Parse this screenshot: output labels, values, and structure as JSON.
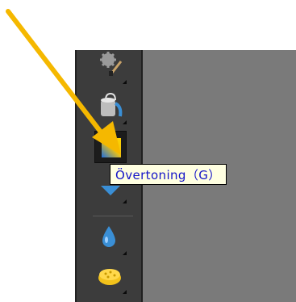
{
  "tooltip": {
    "text": "Övertoning（G）"
  },
  "tools": [
    {
      "name": "gear-brush-tool"
    },
    {
      "name": "paint-bucket-tool"
    },
    {
      "name": "gradient-tool",
      "selected": true
    },
    {
      "name": "shape-tool"
    },
    {
      "name": "blur-drop-tool"
    },
    {
      "name": "sponge-tool"
    }
  ],
  "colors": {
    "toolbar": "#3c3c3c",
    "canvas": "#7a7a7a",
    "annotation_arrow": "#f5b800",
    "tooltip_bg": "#ffffe1",
    "tooltip_text": "#1414c8"
  }
}
